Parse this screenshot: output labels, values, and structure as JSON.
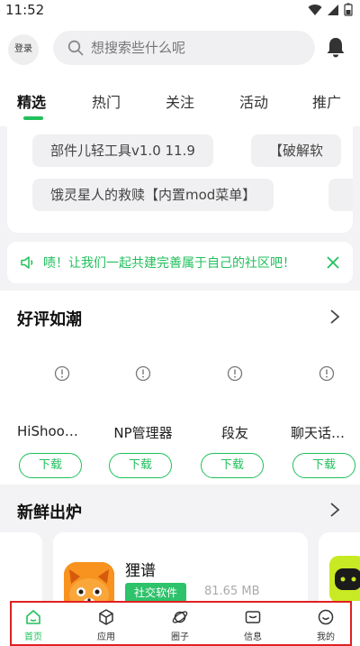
{
  "status": {
    "time": "11:52"
  },
  "header": {
    "login_label": "登录",
    "search_placeholder": "想搜索些什么呢"
  },
  "tabs": [
    {
      "label": "精选",
      "active": true
    },
    {
      "label": "热门"
    },
    {
      "label": "关注"
    },
    {
      "label": "活动"
    },
    {
      "label": "推广"
    }
  ],
  "hot_chips": [
    "部件儿轻工具v1.0 11.9",
    "【破解软",
    "饿灵星人的救赎【内置mod菜单】"
  ],
  "notice": {
    "text": "啧！让我们一起共建完善属于自己的社区吧！"
  },
  "good_reviews": {
    "title": "好评如潮",
    "apps": [
      {
        "name": "HiShoo…",
        "download_label": "下载"
      },
      {
        "name": "NP管理器",
        "download_label": "下载"
      },
      {
        "name": "段友",
        "download_label": "下载"
      },
      {
        "name": "聊天话…",
        "download_label": "下载"
      }
    ]
  },
  "fresh": {
    "title": "新鲜出炉",
    "app": {
      "name": "狸谱",
      "tag": "社交软件",
      "size": "81.65 MB"
    }
  },
  "bottom_nav": [
    {
      "label": "首页",
      "icon": "home-icon",
      "active": true
    },
    {
      "label": "应用",
      "icon": "box-icon"
    },
    {
      "label": "圈子",
      "icon": "planet-icon"
    },
    {
      "label": "信息",
      "icon": "mail-icon"
    },
    {
      "label": "我的",
      "icon": "smile-icon"
    }
  ],
  "colors": {
    "accent": "#21c05c",
    "highlight_outline": "#e02020"
  }
}
